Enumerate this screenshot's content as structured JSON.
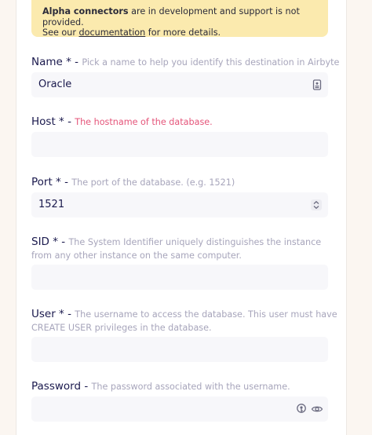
{
  "alert": {
    "bold": "Alpha connectors",
    "text1": " are in development and support is not provided.",
    "text2": "See our ",
    "link": "documentation",
    "text3": " for more details."
  },
  "fields": {
    "name": {
      "label": "Name * - ",
      "description": "Pick a name to help you identify this destination in Airbyte",
      "value": "Oracle",
      "icon": "contact-card-icon"
    },
    "host": {
      "label": "Host * - ",
      "description": "The hostname of the database.",
      "value": ""
    },
    "port": {
      "label": "Port * - ",
      "description": "The port of the database. (e.g. 1521)",
      "value": "1521",
      "icon": "stepper-icon"
    },
    "sid": {
      "label": "SID * - ",
      "description": "The System Identifier uniquely distinguishes the instance from any other instance on the same computer.",
      "value": ""
    },
    "user": {
      "label": "User * - ",
      "description": "The username to access the database. This user must have CREATE USER privileges in the database.",
      "value": ""
    },
    "password": {
      "label": "Password - ",
      "description": "The password associated with the username.",
      "value": "",
      "icons": [
        "key-icon",
        "eye-icon"
      ]
    }
  },
  "colors": {
    "background": "#fbf6f1",
    "card": "#ffffff",
    "alert": "#fbeaae",
    "label": "#1a194d",
    "description": "#a7a5bb",
    "error": "#e5557a",
    "input": "#f7f7fa"
  }
}
